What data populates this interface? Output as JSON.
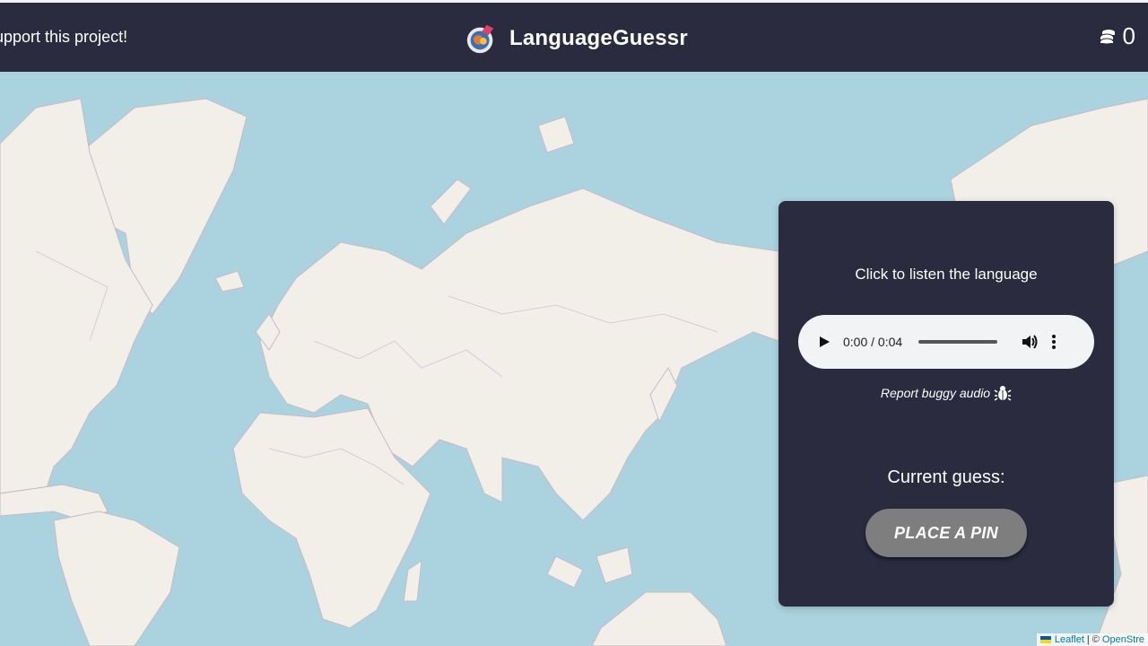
{
  "header": {
    "support_text": "upport this project!",
    "title": "LanguageGuessr",
    "coins": "0",
    "coins_icon": "coins-icon",
    "logo_icon": "globe-logo-icon"
  },
  "panel": {
    "listen_text": "Click to listen the language",
    "audio": {
      "time": "0:00 / 0:04",
      "play_icon": "play-icon",
      "volume_icon": "volume-icon",
      "more_icon": "more-vert-icon"
    },
    "report_text": "Report buggy audio",
    "report_icon": "bug-icon",
    "guess_label": "Current guess:",
    "pin_button": "PLACE A PIN"
  },
  "attribution": {
    "leaflet": "Leaflet",
    "separator": "| ©",
    "osm": "OpenStre"
  },
  "colors": {
    "header_bg": "#2a2b3e",
    "panel_bg": "#2a2b3e",
    "ocean": "#aad3df",
    "land": "#f2efe9",
    "button": "#7e7e7e"
  }
}
